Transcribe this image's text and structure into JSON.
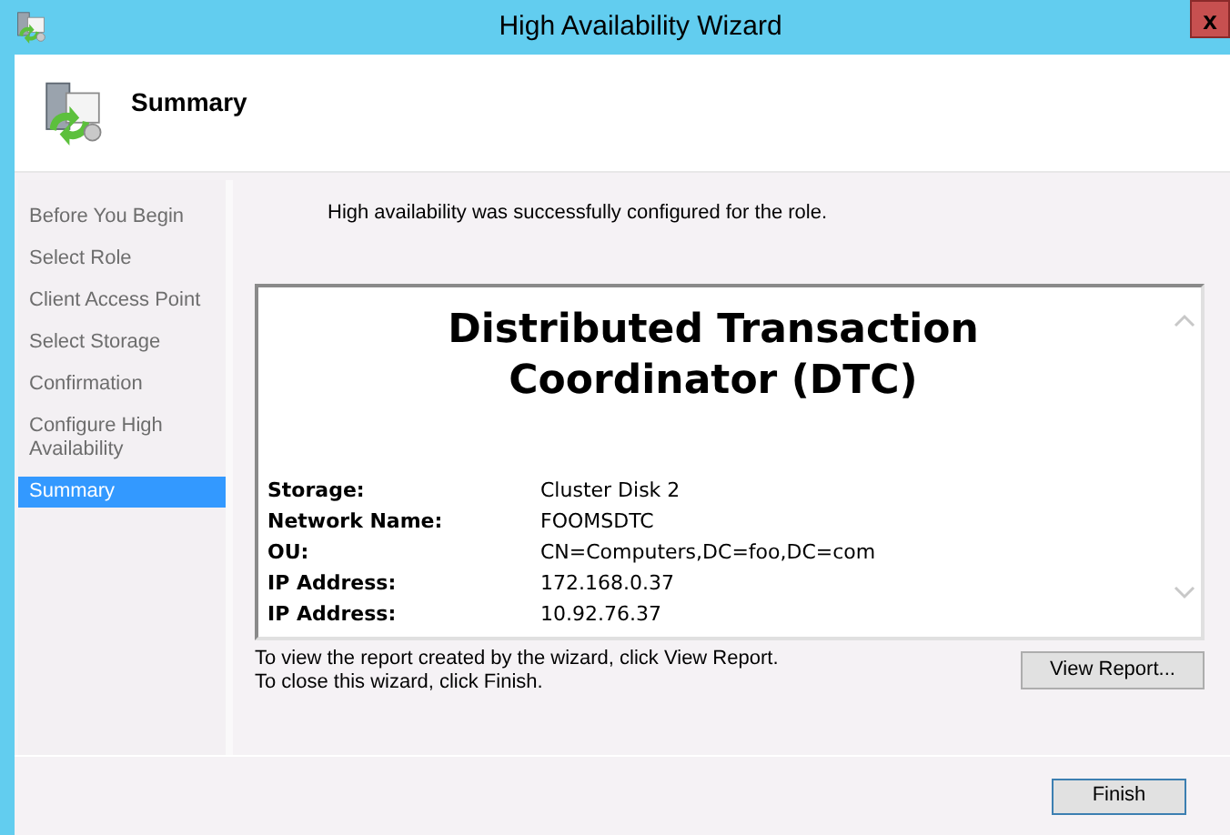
{
  "window": {
    "title": "High Availability Wizard",
    "close": "x"
  },
  "header": {
    "title": "Summary"
  },
  "steps": [
    {
      "label": "Before You Begin",
      "selected": false
    },
    {
      "label": "Select Role",
      "selected": false
    },
    {
      "label": "Client Access Point",
      "selected": false
    },
    {
      "label": "Select Storage",
      "selected": false
    },
    {
      "label": "Confirmation",
      "selected": false
    },
    {
      "label": "Configure High Availability",
      "selected": false
    },
    {
      "label": "Summary",
      "selected": true
    }
  ],
  "message": "High availability was successfully configured for the role.",
  "report": {
    "title": "Distributed Transaction Coordinator (DTC)",
    "rows": [
      {
        "label": "Storage:",
        "value": "Cluster Disk 2"
      },
      {
        "label": "Network Name:",
        "value": "FOOMSDTC"
      },
      {
        "label": "OU:",
        "value": "CN=Computers,DC=foo,DC=com"
      },
      {
        "label": "IP Address:",
        "value": "172.168.0.37"
      },
      {
        "label": "IP Address:",
        "value": "10.92.76.37"
      }
    ]
  },
  "hints": [
    "To view the report created by the wizard, click View Report.",
    "To close this wizard, click Finish."
  ],
  "view_report_button": "View Report...",
  "finish_button": "Finish"
}
